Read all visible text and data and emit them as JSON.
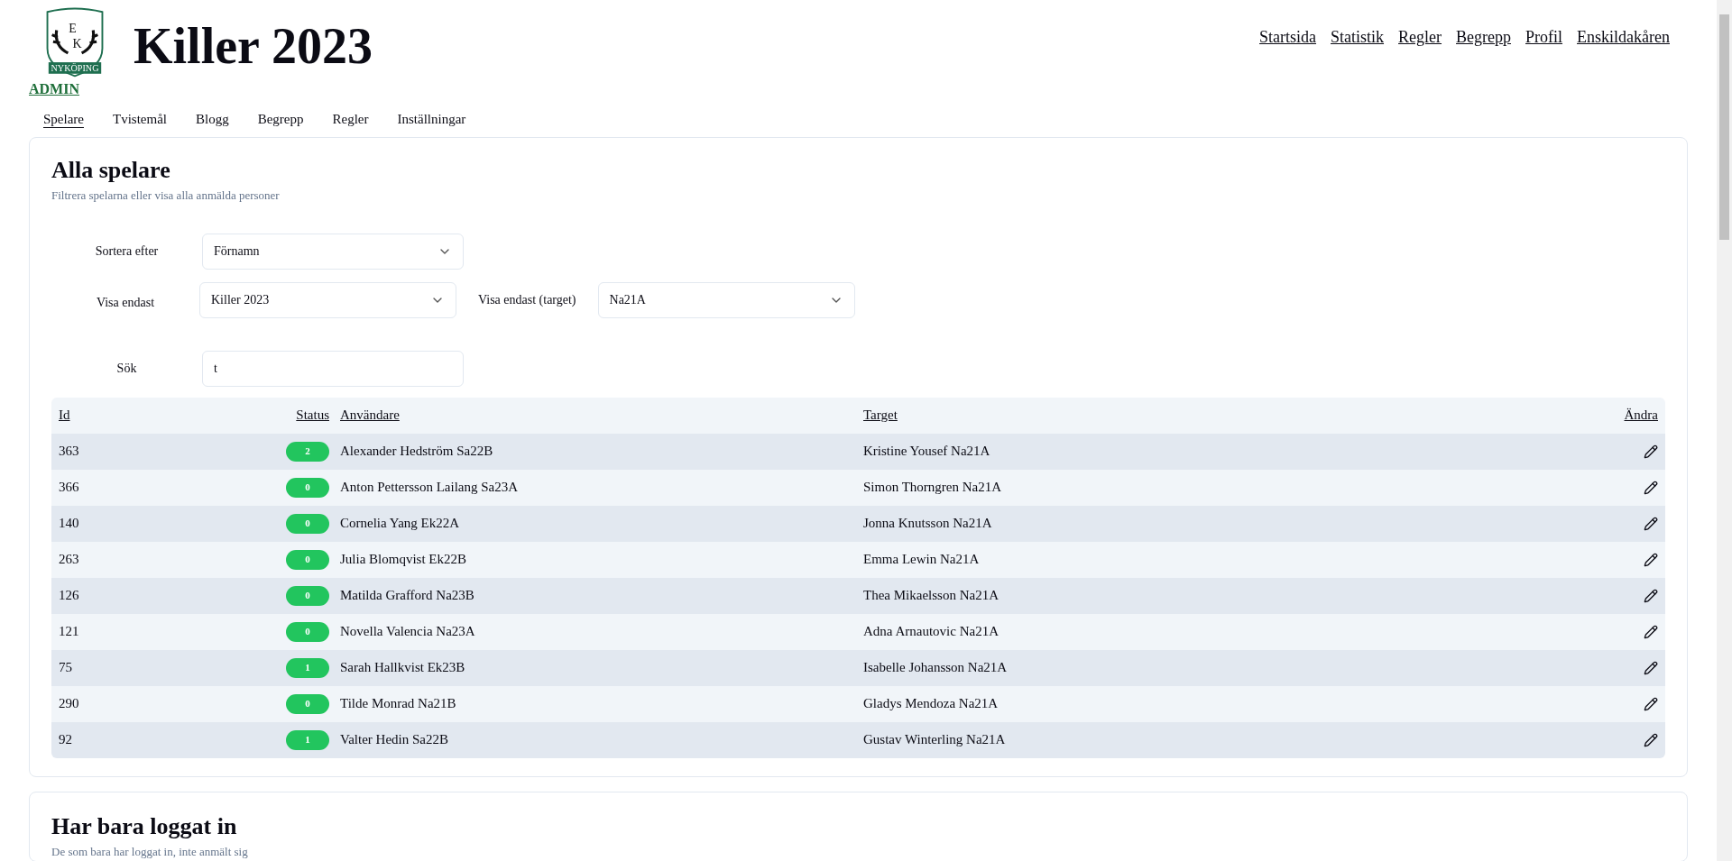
{
  "logo": {
    "letter_top": "E",
    "letter_bottom": "K",
    "ribbon": "NYKÖPING"
  },
  "title": "Killer 2023",
  "nav_links": [
    "Startsida",
    "Statistik",
    "Regler",
    "Begrepp",
    "Profil",
    "Enskildakåren"
  ],
  "admin_link": "ADMIN",
  "tabs": [
    {
      "label": "Spelare",
      "selected": true
    },
    {
      "label": "Tvistemål",
      "selected": false
    },
    {
      "label": "Blogg",
      "selected": false
    },
    {
      "label": "Begrepp",
      "selected": false
    },
    {
      "label": "Regler",
      "selected": false
    },
    {
      "label": "Inställningar",
      "selected": false
    }
  ],
  "players_card": {
    "title": "Alla spelare",
    "subtitle": "Filtrera spelarna eller visa alla anmälda personer",
    "sort": {
      "label": "Sortera efter",
      "value": "Förnamn"
    },
    "filter": {
      "label": "Visa endast",
      "value": "Killer 2023"
    },
    "target_filter": {
      "label": "Visa endast (target)",
      "value": "Na21A"
    },
    "search": {
      "label": "Sök",
      "value": "t"
    },
    "table": {
      "columns": [
        "Id",
        "Status",
        "Användare",
        "Target",
        "Ändra"
      ],
      "rows": [
        {
          "id": "363",
          "status": "2",
          "user": "Alexander Hedström Sa22B",
          "target": "Kristine Yousef Na21A"
        },
        {
          "id": "366",
          "status": "0",
          "user": "Anton Pettersson Lailang Sa23A",
          "target": "Simon Thorngren Na21A"
        },
        {
          "id": "140",
          "status": "0",
          "user": "Cornelia Yang Ek22A",
          "target": "Jonna Knutsson Na21A"
        },
        {
          "id": "263",
          "status": "0",
          "user": "Julia Blomqvist Ek22B",
          "target": "Emma Lewin Na21A"
        },
        {
          "id": "126",
          "status": "0",
          "user": "Matilda Grafford Na23B",
          "target": "Thea Mikaelsson Na21A"
        },
        {
          "id": "121",
          "status": "0",
          "user": "Novella Valencia Na23A",
          "target": "Adna Arnautovic Na21A"
        },
        {
          "id": "75",
          "status": "1",
          "user": "Sarah Hallkvist Ek23B",
          "target": "Isabelle Johansson Na21A"
        },
        {
          "id": "290",
          "status": "0",
          "user": "Tilde Monrad Na21B",
          "target": "Gladys Mendoza Na21A"
        },
        {
          "id": "92",
          "status": "1",
          "user": "Valter Hedin Sa22B",
          "target": "Gustav Winterling Na21A"
        }
      ]
    }
  },
  "login_card": {
    "title": "Har bara loggat in",
    "subtitle": "De som bara har loggat in, inte anmält sig"
  }
}
